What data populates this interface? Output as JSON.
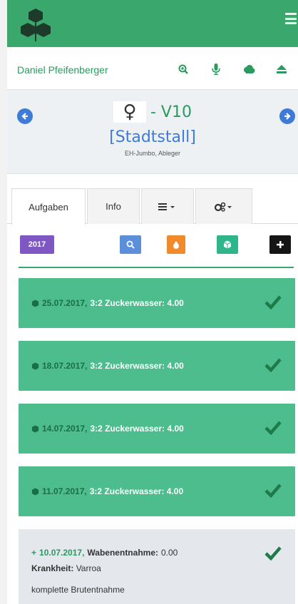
{
  "header": {
    "user_name": "Daniel Pfeifenberger"
  },
  "hive": {
    "symbol": "♀",
    "code": "- V10",
    "location": "[Stadtstall]",
    "subtitle": "EH-Jumbo, Ableger"
  },
  "tabs": [
    {
      "label": "Aufgaben"
    },
    {
      "label": "Info"
    },
    {
      "label": "≡▾"
    },
    {
      "label": "⚙▾"
    }
  ],
  "toolbar": {
    "year_label": "2017"
  },
  "entries": [
    {
      "date": "25.07.2017,",
      "text": "3:2 Zuckerwasser: 4.00"
    },
    {
      "date": "18.07.2017,",
      "text": "3:2 Zuckerwasser: 4.00"
    },
    {
      "date": "14.07.2017,",
      "text": "3:2 Zuckerwasser: 4.00"
    },
    {
      "date": "11.07.2017,",
      "text": "3:2 Zuckerwasser: 4.00"
    }
  ],
  "detail_entry": {
    "plus": "+",
    "date": "10.07.2017,",
    "name": "Wabenentnahme:",
    "value": "0.00",
    "disease_label": "Krankheit:",
    "disease_value": "Varroa",
    "note": "komplette Brutentnahme"
  },
  "colors": {
    "primary_green": "#3aa76d",
    "entry_green": "#4dbd8e",
    "accent_blue": "#3d7bd6",
    "year_purple": "#7e57c2",
    "orange": "#f08a2a"
  }
}
